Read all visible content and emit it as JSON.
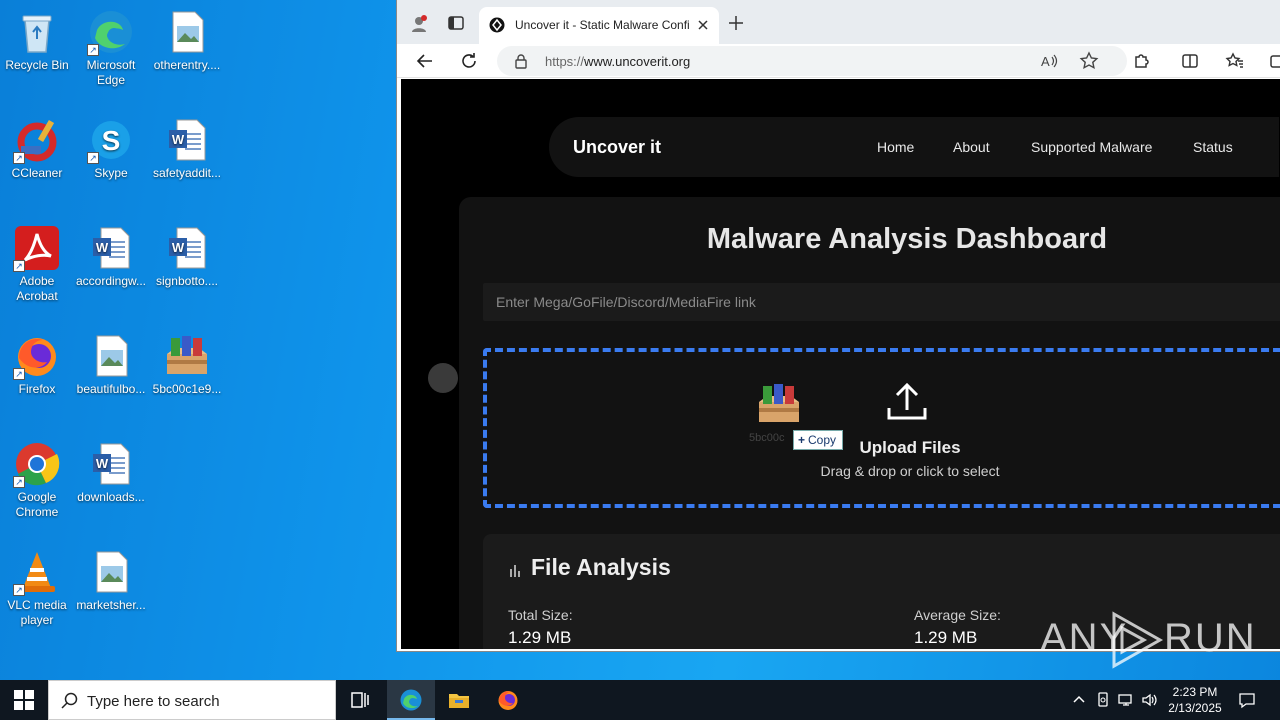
{
  "desktop": {
    "icons": [
      {
        "label": "Recycle Bin",
        "icon": "recycle-bin-icon"
      },
      {
        "label": "Microsoft Edge",
        "icon": "edge-icon"
      },
      {
        "label": "otherentry....",
        "icon": "image-file-icon"
      },
      {
        "label": "CCleaner",
        "icon": "ccleaner-icon"
      },
      {
        "label": "Skype",
        "icon": "skype-icon"
      },
      {
        "label": "safetyaddit...",
        "icon": "word-doc-icon"
      },
      {
        "label": "Adobe Acrobat",
        "icon": "acrobat-icon"
      },
      {
        "label": "accordingw...",
        "icon": "word-doc-icon"
      },
      {
        "label": "signbotto....",
        "icon": "word-doc-icon"
      },
      {
        "label": "Firefox",
        "icon": "firefox-icon"
      },
      {
        "label": "beautifulbo...",
        "icon": "image-file-icon"
      },
      {
        "label": "5bc00c1e9...",
        "icon": "winrar-archive-icon"
      },
      {
        "label": "Google Chrome",
        "icon": "chrome-icon"
      },
      {
        "label": "downloads...",
        "icon": "word-doc-icon"
      },
      {
        "label": "VLC media player",
        "icon": "vlc-icon"
      },
      {
        "label": "marketsher...",
        "icon": "image-file-icon"
      }
    ]
  },
  "browser": {
    "tab": {
      "title": "Uncover it - Static Malware Confi"
    },
    "address": {
      "protocol": "https://",
      "host": "www.uncoverit.org"
    }
  },
  "page": {
    "nav": {
      "brand": "Uncover it",
      "links": [
        "Home",
        "About",
        "Supported Malware",
        "Status"
      ]
    },
    "dashboard_title": "Malware Analysis Dashboard",
    "link_input": {
      "placeholder": "Enter Mega/GoFile/Discord/MediaFire link",
      "value": ""
    },
    "upload": {
      "title": "Upload Files",
      "subtitle": "Drag & drop or click to select",
      "dragged_file_label": "5bc00c",
      "drag_tooltip": "Copy"
    },
    "analysis": {
      "title": "File Analysis",
      "total_size_label": "Total Size:",
      "total_size_value": "1.29 MB",
      "average_size_label": "Average Size:",
      "average_size_value": "1.29 MB"
    }
  },
  "watermark": {
    "left": "ANY",
    "right": "RUN"
  },
  "taskbar": {
    "search_placeholder": "Type here to search",
    "time": "2:23 PM",
    "date": "2/13/2025"
  }
}
